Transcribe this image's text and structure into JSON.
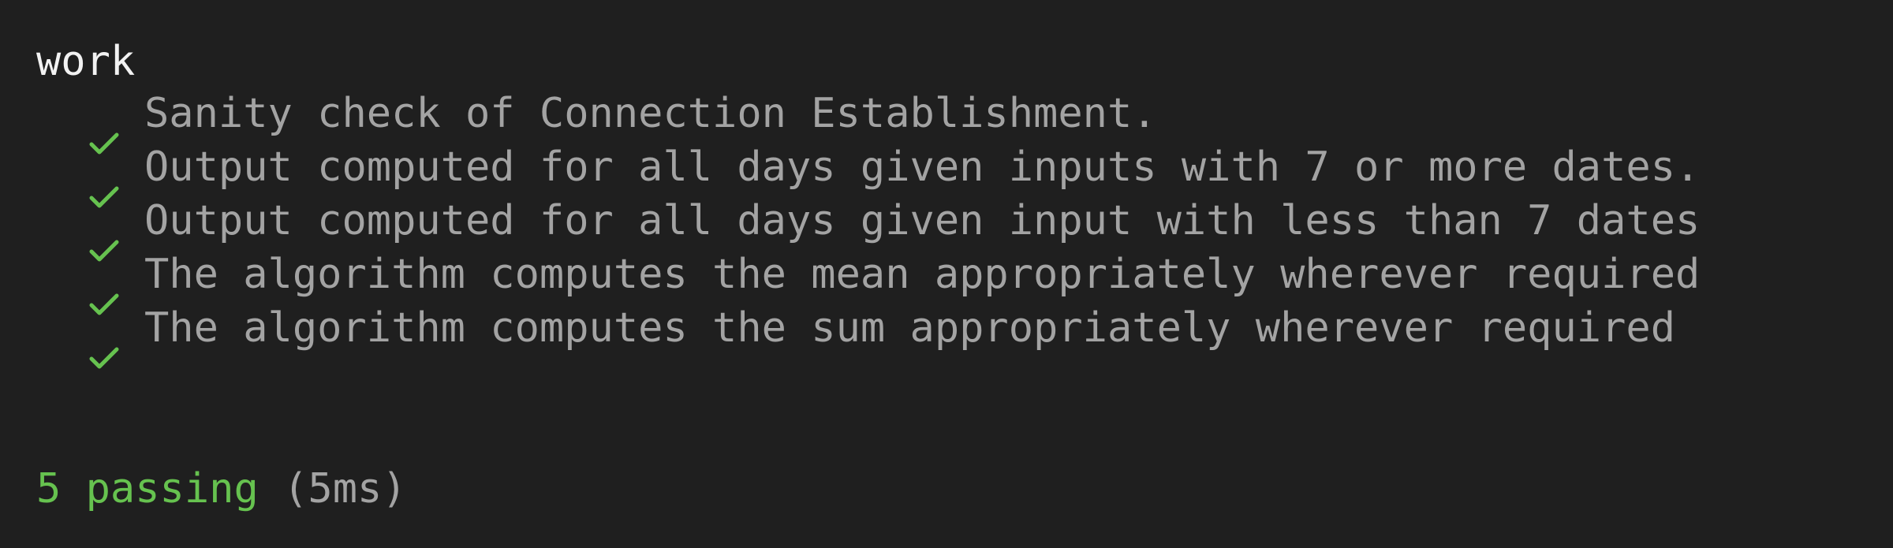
{
  "suite": {
    "title": "work"
  },
  "tests": [
    {
      "status": "pass",
      "icon": "check-icon",
      "title": "Sanity check of Connection Establishment."
    },
    {
      "status": "pass",
      "icon": "check-icon",
      "title": "Output computed for all days given inputs with 7 or more dates."
    },
    {
      "status": "pass",
      "icon": "check-icon",
      "title": "Output computed for all days given input with less than 7 dates"
    },
    {
      "status": "pass",
      "icon": "check-icon",
      "title": "The algorithm computes the mean appropriately wherever required"
    },
    {
      "status": "pass",
      "icon": "check-icon",
      "title": "The algorithm computes the sum appropriately wherever required"
    }
  ],
  "summary": {
    "passing_text": "5 passing",
    "duration_text": "(5ms)"
  },
  "colors": {
    "background": "#1f1f1f",
    "suite_title": "#f2f2f2",
    "test_text": "#a3a3a3",
    "pass_green": "#66c24f"
  }
}
